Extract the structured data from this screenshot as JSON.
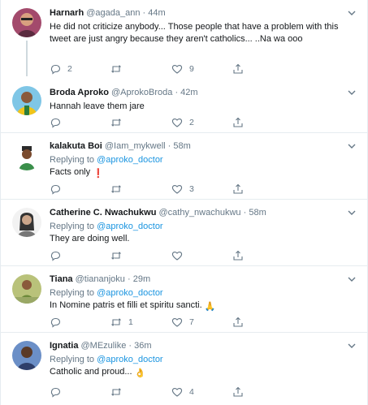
{
  "tweets": [
    {
      "name": "Harnarh",
      "handle": "@agada_ann",
      "time": "44m",
      "text": "He did not criticize anybody... Those people that have a problem with this tweet are just angry because they aren't catholics... ..Na wa ooo",
      "replies": "2",
      "retweets": "",
      "likes": "9"
    },
    {
      "name": "Broda Aproko",
      "handle": "@AprokoBroda",
      "time": "42m",
      "text": "Hannah leave them jare",
      "replies": "",
      "retweets": "",
      "likes": "2"
    },
    {
      "name": "kalakuta Boi",
      "handle": "@Iam_mykwell",
      "time": "58m",
      "replying_label": "Replying to",
      "replying_to": "@aproko_doctor",
      "text": "Facts only",
      "emoji": "❗",
      "replies": "",
      "retweets": "",
      "likes": "3"
    },
    {
      "name": "Catherine C. Nwachukwu",
      "handle": "@cathy_nwachukwu",
      "time": "58m",
      "replying_label": "Replying to",
      "replying_to": "@aproko_doctor",
      "text": "They are doing well.",
      "replies": "",
      "retweets": "",
      "likes": ""
    },
    {
      "name": "Tiana",
      "handle": "@tiananjoku",
      "time": "29m",
      "replying_label": "Replying to",
      "replying_to": "@aproko_doctor",
      "text": "In Nomine patris et filli et spiritu sancti.",
      "emoji": "🙏",
      "replies": "",
      "retweets": "1",
      "likes": "7"
    },
    {
      "name": "Ignatia",
      "handle": "@MEzulike",
      "time": "36m",
      "replying_label": "Replying to",
      "replying_to": "@aproko_doctor",
      "text": "Catholic and proud...",
      "emoji": "👌",
      "replies": "",
      "retweets": "",
      "likes": "4"
    }
  ],
  "separator": "·",
  "colors": {
    "link": "#1b95e0",
    "muted": "#657786",
    "border": "#e6ecf0",
    "alert": "#e0245e"
  },
  "icons": [
    "reply-icon",
    "retweet-icon",
    "like-icon",
    "share-icon",
    "chevron-down-icon"
  ]
}
